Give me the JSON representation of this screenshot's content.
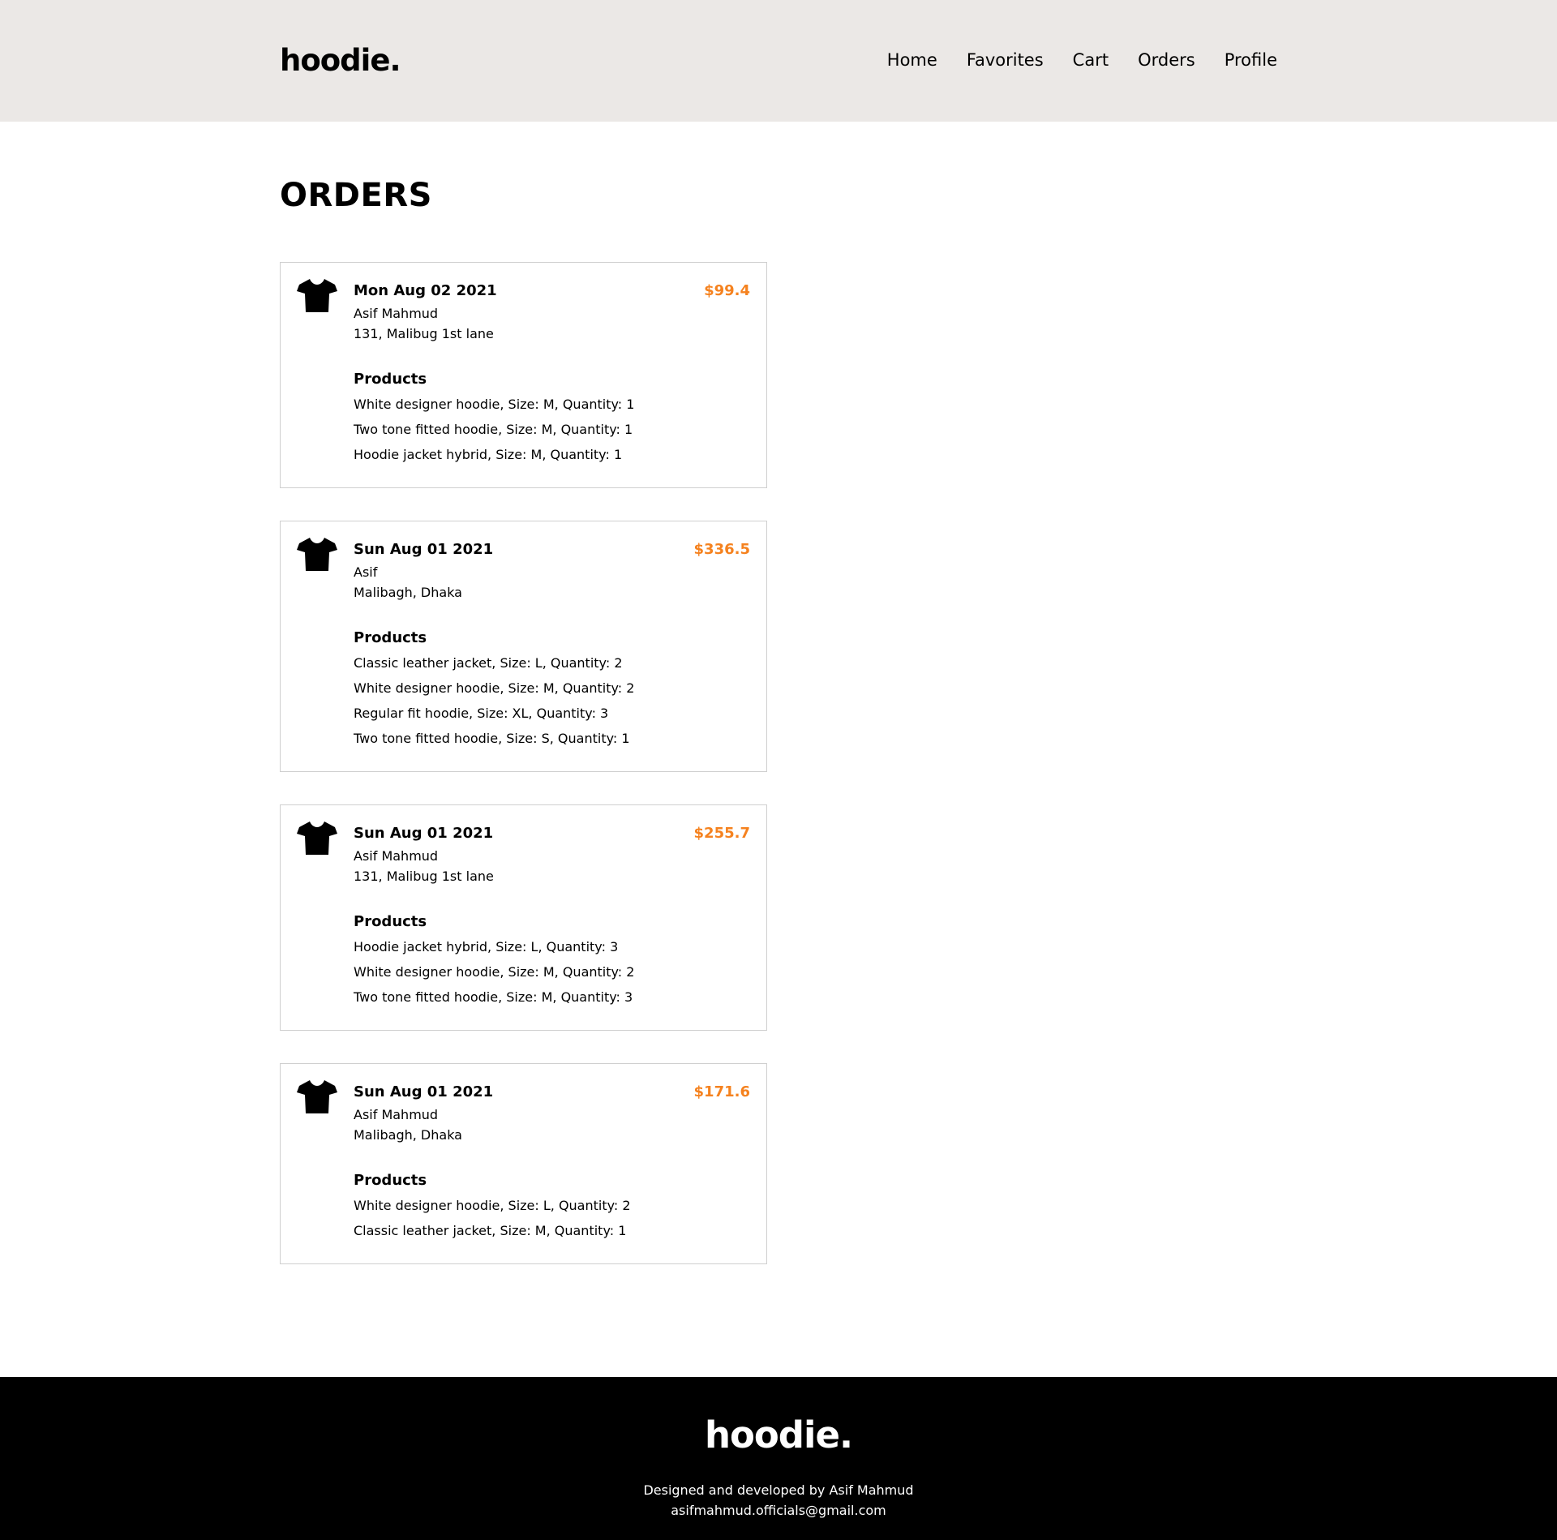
{
  "header": {
    "logo": "hoodie.",
    "nav": [
      "Home",
      "Favorites",
      "Cart",
      "Orders",
      "Profile"
    ]
  },
  "main": {
    "title": "ORDERS",
    "products_heading": "Products",
    "orders": [
      {
        "date": "Mon Aug 02 2021",
        "total": "$99.4",
        "name": "Asif Mahmud",
        "address": "131, Malibug 1st lane",
        "products": [
          "White designer hoodie, Size: M, Quantity: 1",
          "Two tone fitted hoodie, Size: M, Quantity: 1",
          "Hoodie jacket hybrid, Size: M, Quantity: 1"
        ]
      },
      {
        "date": "Sun Aug 01 2021",
        "total": "$336.5",
        "name": "Asif",
        "address": "Malibagh, Dhaka",
        "products": [
          "Classic leather jacket, Size: L, Quantity: 2",
          "White designer hoodie, Size: M, Quantity: 2",
          "Regular fit hoodie, Size: XL, Quantity: 3",
          "Two tone fitted hoodie, Size: S, Quantity: 1"
        ]
      },
      {
        "date": "Sun Aug 01 2021",
        "total": "$255.7",
        "name": "Asif Mahmud",
        "address": "131, Malibug 1st lane",
        "products": [
          "Hoodie jacket hybrid, Size: L, Quantity: 3",
          "White designer hoodie, Size: M, Quantity: 2",
          "Two tone fitted hoodie, Size: M, Quantity: 3"
        ]
      },
      {
        "date": "Sun Aug 01 2021",
        "total": "$171.6",
        "name": "Asif Mahmud",
        "address": "Malibagh, Dhaka",
        "products": [
          "White designer hoodie, Size: L, Quantity: 2",
          "Classic leather jacket, Size: M, Quantity: 1"
        ]
      }
    ]
  },
  "footer": {
    "logo": "hoodie.",
    "credit": "Designed and developed by Asif Mahmud",
    "email": "asifmahmud.officials@gmail.com"
  },
  "colors": {
    "header_bg": "#ebe8e6",
    "price": "#f5821f",
    "footer_bg": "#000000"
  },
  "icons": {
    "order_icon": "tshirt-icon"
  }
}
